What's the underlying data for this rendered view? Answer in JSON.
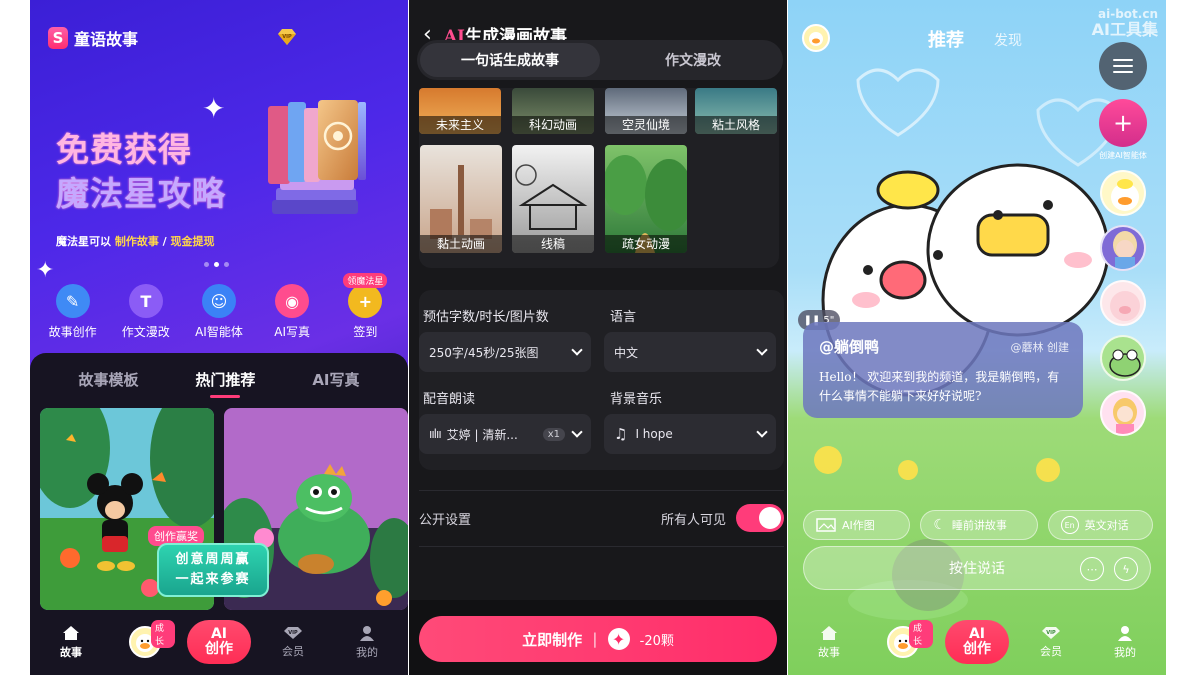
{
  "panel1": {
    "app_name": "童语故事",
    "vip_label": "VIP",
    "hero_title_line1": "免费获得",
    "hero_title_line2": "魔法星攻略",
    "hero_sub_prefix": "魔法星可以",
    "hero_sub_link1": "制作故事",
    "hero_sub_sep": " / ",
    "hero_sub_link2": "现金提现",
    "quick_actions": [
      {
        "label": "故事创作",
        "icon": "quill-icon",
        "color": "#3f8af5"
      },
      {
        "label": "作文漫改",
        "icon": "t-icon",
        "color": "#8b5cf6"
      },
      {
        "label": "AI智能体",
        "icon": "robot-icon",
        "color": "#3b82f6"
      },
      {
        "label": "AI写真",
        "icon": "camera-icon",
        "color": "#ff4c8e"
      },
      {
        "label": "签到",
        "icon": "coin-icon",
        "color": "#f2b91f",
        "badge": "领魔法星"
      }
    ],
    "tabs": [
      "故事模板",
      "热门推荐",
      "AI写真"
    ],
    "active_tab": "热门推荐",
    "promo_badge": "创作赢奖",
    "promo_line1": "创意周周赢",
    "promo_line2": "一起来参赛",
    "nav": {
      "story": "故事",
      "grow_badge": "成长",
      "create_top": "AI",
      "create": "创作",
      "member": "会员",
      "mine": "我的",
      "vip_small": "VIP"
    }
  },
  "panel2": {
    "ai_prefix": "AI",
    "title_rest": "生成漫画故事",
    "seg_tabs": [
      "一句话生成故事",
      "作文漫改"
    ],
    "styles_row1": [
      "未来主义",
      "科幻动画",
      "空灵仙境",
      "粘土风格"
    ],
    "styles_row2": [
      "黏土动画",
      "线稿",
      "疏女动漫"
    ],
    "estimate_label": "预估字数/时长/图片数",
    "estimate_value": "250字/45秒/25张图",
    "language_label": "语言",
    "language_value": "中文",
    "voice_label": "配音朗读",
    "voice_value": "艾婷 | 清新...",
    "voice_speed": "x1",
    "music_label": "背景音乐",
    "music_value": "I hope",
    "public_label": "公开设置",
    "public_value": "所有人可见",
    "make_label": "立即制作",
    "make_cost": "-20颗"
  },
  "panel3": {
    "tab_recommend": "推荐",
    "tab_discover": "发现",
    "watermark_line1": "ai-bot.cn",
    "watermark_line2": "AI工具集",
    "create_agent_caption": "创建AI智能体",
    "voice_duration": "5\"",
    "char_name": "@躺倒鸭",
    "creator": "@蘑林 创建",
    "greeting": "Hello！ 欢迎来到我的频道，我是躺倒鸭，有什么事情不能躺下来好好说呢?",
    "chips": [
      {
        "label": "AI作图",
        "icon": "image-icon"
      },
      {
        "label": "睡前讲故事",
        "icon": "moon-icon"
      },
      {
        "label": "英文对话",
        "icon": "en-icon",
        "glyph": "En"
      }
    ],
    "talk_label": "按住说话",
    "nav": {
      "story": "故事",
      "grow_badge": "成长",
      "create_top": "AI",
      "create": "创作",
      "member": "会员",
      "mine": "我的",
      "vip_small": "VIP"
    }
  }
}
